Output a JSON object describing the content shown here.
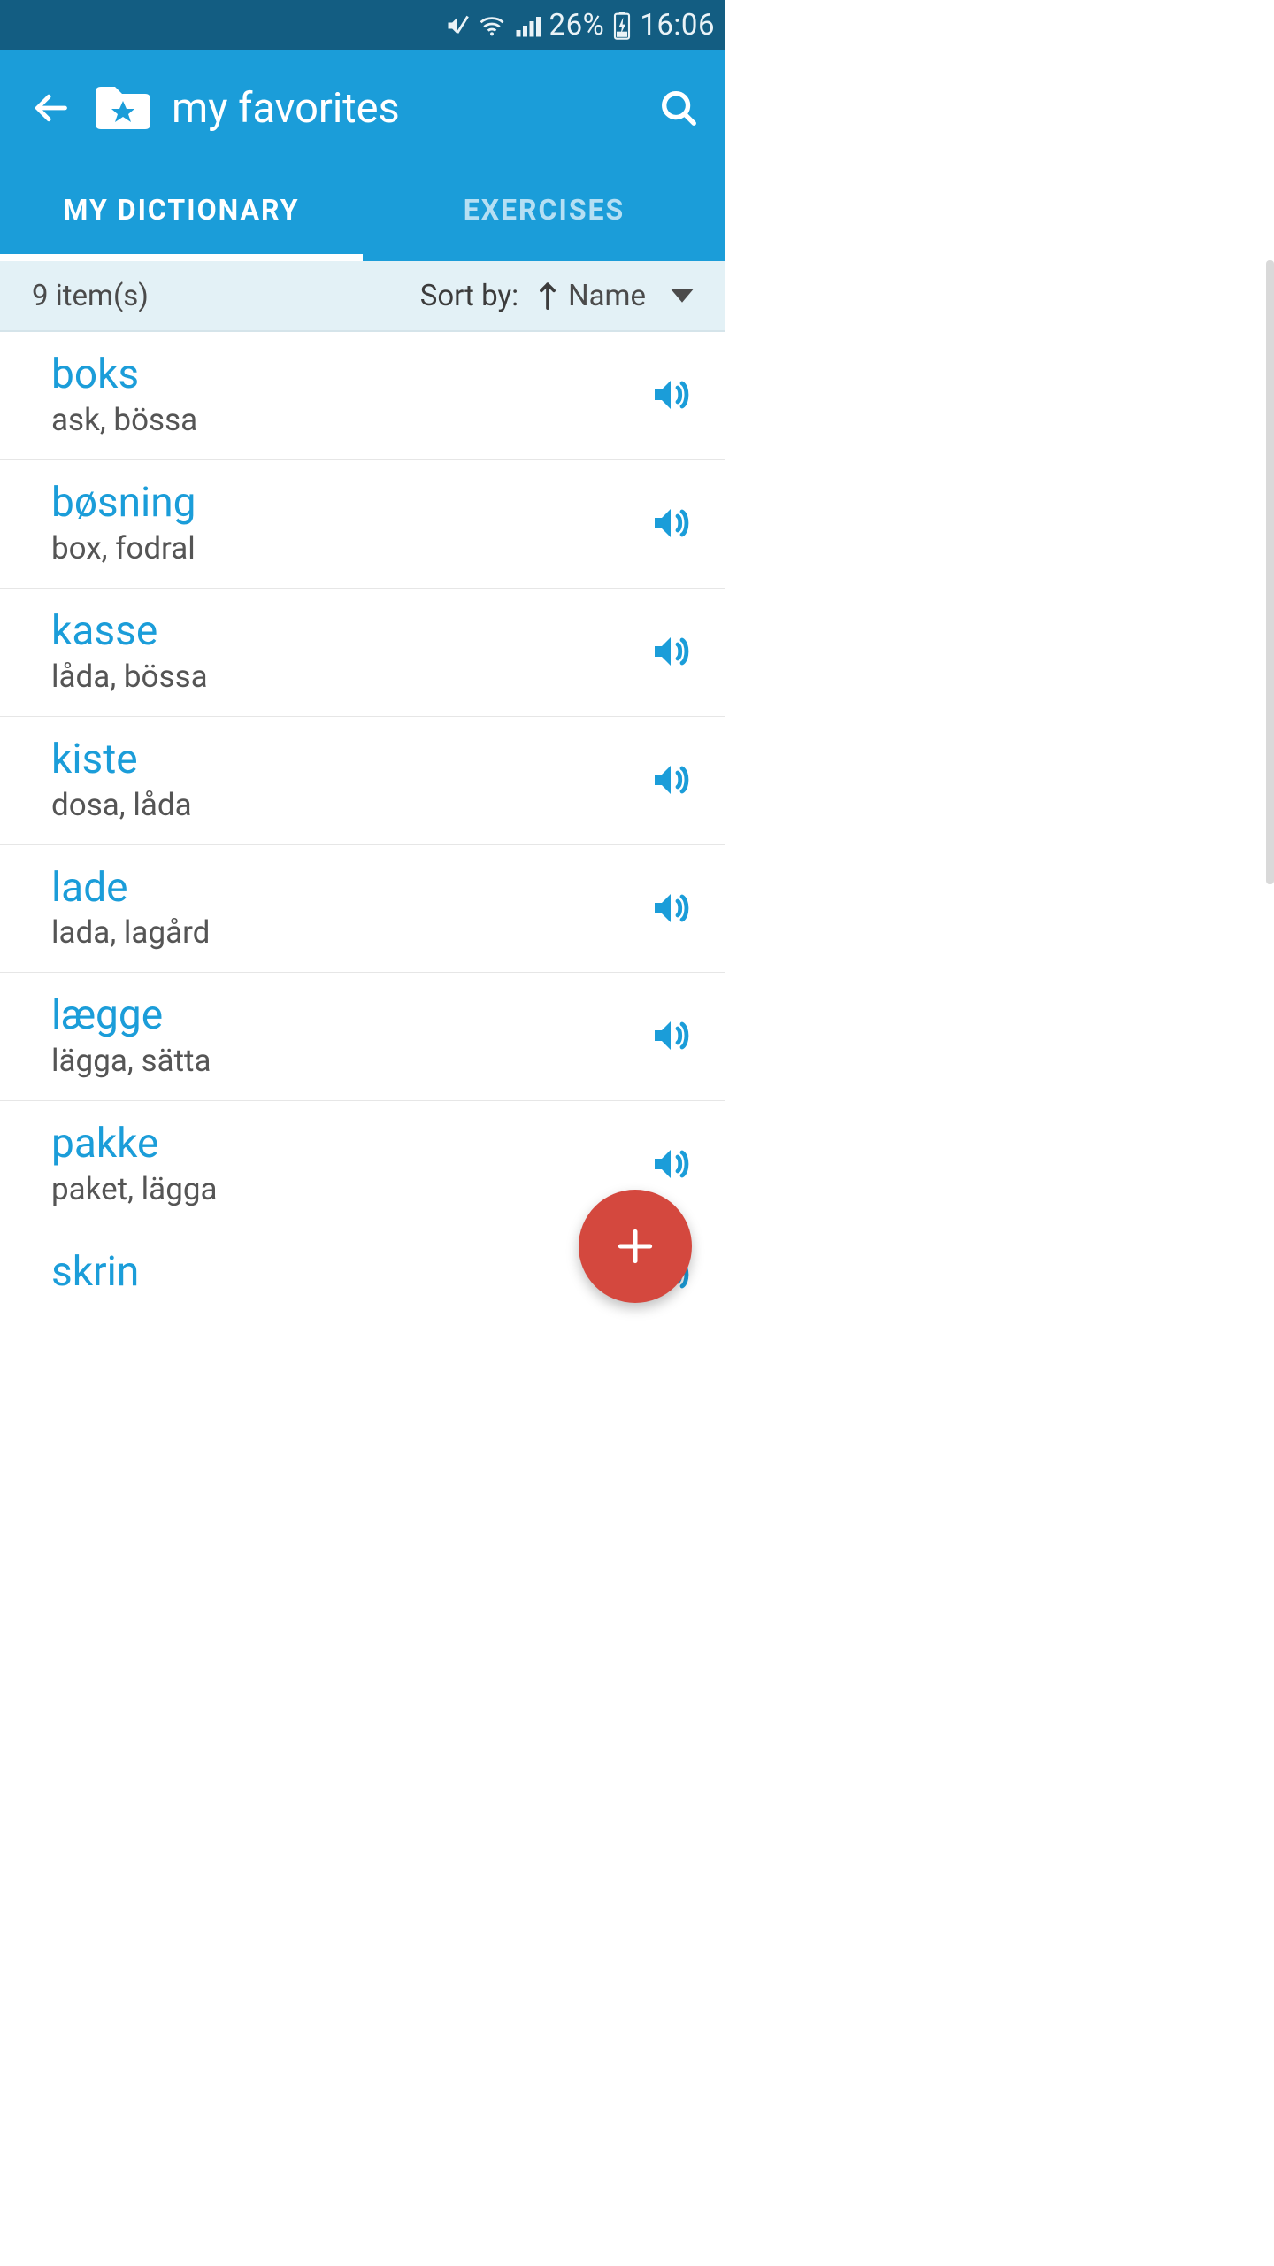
{
  "status_bar": {
    "battery_pct": "26%",
    "time": "16:06"
  },
  "header": {
    "title": "my favorites"
  },
  "tabs": {
    "dictionary": "MY DICTIONARY",
    "exercises": "EXERCISES",
    "active": "dictionary"
  },
  "subheader": {
    "count_text": "9 item(s)",
    "sort_by_label": "Sort by:",
    "sort_field": "Name",
    "sort_dir": "asc"
  },
  "items": [
    {
      "word": "boks",
      "defn": "ask, bössa"
    },
    {
      "word": "bøsning",
      "defn": "box, fodral"
    },
    {
      "word": "kasse",
      "defn": "låda, bössa"
    },
    {
      "word": "kiste",
      "defn": "dosa, låda"
    },
    {
      "word": "lade",
      "defn": "lada, lagård"
    },
    {
      "word": "lægge",
      "defn": "lägga, sätta"
    },
    {
      "word": "pakke",
      "defn": "paket, lägga"
    },
    {
      "word": "skrin",
      "defn": ""
    }
  ]
}
